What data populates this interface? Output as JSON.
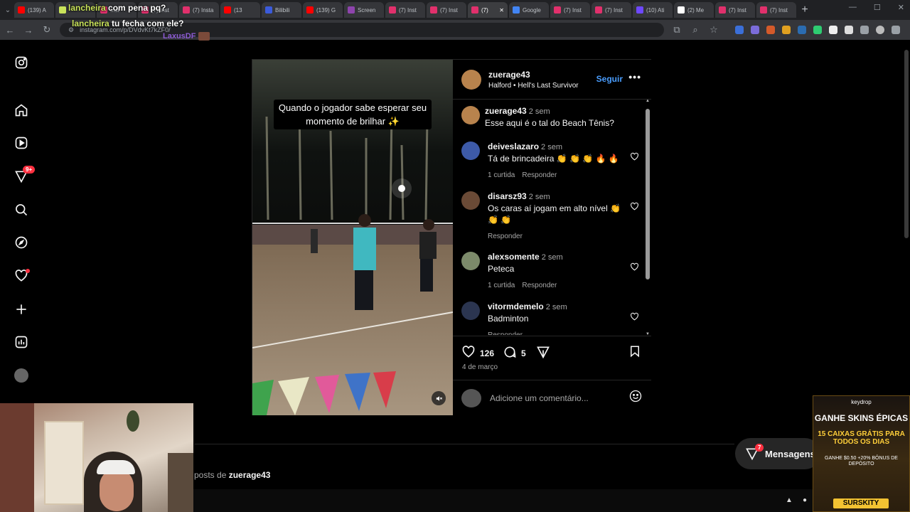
{
  "browser": {
    "tabs": [
      {
        "label": "(139) A",
        "color": "#ff0000"
      },
      {
        "label": "",
        "color": "#c9e35a"
      },
      {
        "label": "Inst",
        "color": "#e1306c"
      },
      {
        "label": "(7) Inst",
        "color": "#e1306c"
      },
      {
        "label": "(7) Insta",
        "color": "#e1306c"
      },
      {
        "label": "(13",
        "color": "#ff0000"
      },
      {
        "label": "Bilibili",
        "color": "#3b5bdb"
      },
      {
        "label": "(139) G",
        "color": "#ff0000"
      },
      {
        "label": "Screen",
        "color": "#8e44ad"
      },
      {
        "label": "(7) Inst",
        "color": "#e1306c"
      },
      {
        "label": "(7) Inst",
        "color": "#e1306c"
      },
      {
        "label": "(7)",
        "color": "#e1306c",
        "active": true
      },
      {
        "label": "Google",
        "color": "#4285f4"
      },
      {
        "label": "(7) Inst",
        "color": "#e1306c"
      },
      {
        "label": "(7) Inst",
        "color": "#e1306c"
      },
      {
        "label": "(10) Ati",
        "color": "#6e48ff"
      },
      {
        "label": "(2) Me",
        "color": "#ffffff"
      },
      {
        "label": "(7) Inst",
        "color": "#e1306c"
      },
      {
        "label": "(7) Inst",
        "color": "#e1306c"
      }
    ],
    "new_tab": "+",
    "url": "instagram.com/p/DVdvKt7kZF0/"
  },
  "overlay_chat": {
    "line1_user": "lancheira",
    "line1_msg": "com pena pq?",
    "line2_user": "lancheira",
    "line2_msg": "tu fecha com ele?",
    "line3_user": "LaxusDF"
  },
  "sidebar": {
    "notif_badge": "9+"
  },
  "post": {
    "media_caption": "Quando o jogador sabe esperar seu momento de brilhar ✨",
    "author": "zuerage43",
    "location": "Halford",
    "audio": "Hell's Last Survivor",
    "location_sep": "•",
    "follow_label": "Seguir",
    "more_label": "•••",
    "caption_comment": {
      "user": "zuerage43",
      "time": "2 sem",
      "text": "Esse aqui é o tal do Beach Tênis?"
    },
    "comments": [
      {
        "user": "deiveslazaro",
        "time": "2 sem",
        "text": "Tá de brincadeira 👏 👏 👏 🔥 🔥",
        "likes": "1 curtida",
        "reply": "Responder",
        "avatar_color": "#3d5aa8"
      },
      {
        "user": "disarsz93",
        "time": "2 sem",
        "text": "Os caras aí jogam em alto nível 👏 👏 👏",
        "likes": "",
        "reply": "Responder",
        "avatar_color": "#6a4a36"
      },
      {
        "user": "alexsomente",
        "time": "2 sem",
        "text": "Peteca",
        "likes": "1 curtida",
        "reply": "Responder",
        "avatar_color": "#7c8a6a"
      },
      {
        "user": "vitormdemelo",
        "time": "2 sem",
        "text": "Badminton",
        "likes": "",
        "reply": "Responder",
        "avatar_color": "#2b3550"
      }
    ],
    "like_count": "126",
    "comment_count": "5",
    "date": "4 de março",
    "add_comment_placeholder": "Adicione um comentário..."
  },
  "more_posts": {
    "prefix": "posts de",
    "user": "zuerage43"
  },
  "messages": {
    "label": "Mensagens",
    "badge": "7"
  },
  "ad": {
    "brand": "keydrop",
    "headline": "GANHE SKINS ÉPICAS",
    "offer": "15 CAIXAS GRÁTIS PARA TODOS OS DIAS",
    "bonus": "GANHE $0.50 +20% BÔNUS DE DEPÓSITO",
    "code": "SURSKITY"
  }
}
